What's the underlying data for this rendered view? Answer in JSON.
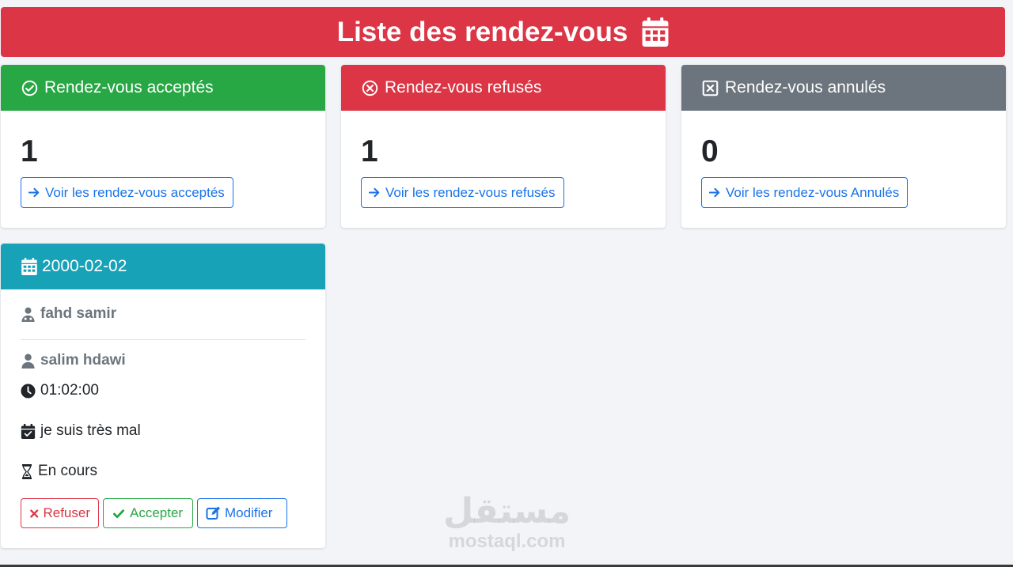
{
  "page": {
    "title": "Liste des rendez-vous",
    "title_icon": "calendar-icon"
  },
  "stats": [
    {
      "label": "Rendez-vous acceptés",
      "icon": "check-circle-icon",
      "count": "1",
      "link_label": "Voir les rendez-vous acceptés",
      "color": "#28a745"
    },
    {
      "label": "Rendez-vous refusés",
      "icon": "x-circle-icon",
      "count": "1",
      "link_label": "Voir les rendez-vous refusés",
      "color": "#dc3545"
    },
    {
      "label": "Rendez-vous annulés",
      "icon": "x-square-icon",
      "count": "0",
      "link_label": "Voir les rendez-vous Annulés",
      "color": "#6c757d"
    }
  ],
  "appointment": {
    "date": "2000-02-02",
    "doctor": "fahd samir",
    "patient": "salim hdawi",
    "time": "01:02:00",
    "reason": "je suis très mal",
    "status": "En cours",
    "header_color": "#17a2b8"
  },
  "actions": {
    "refuse_label": "Refuser",
    "accept_label": "Accepter",
    "edit_label": "Modifier"
  },
  "watermark": {
    "arabic": "مستقل",
    "latin": "mostaql.com"
  }
}
